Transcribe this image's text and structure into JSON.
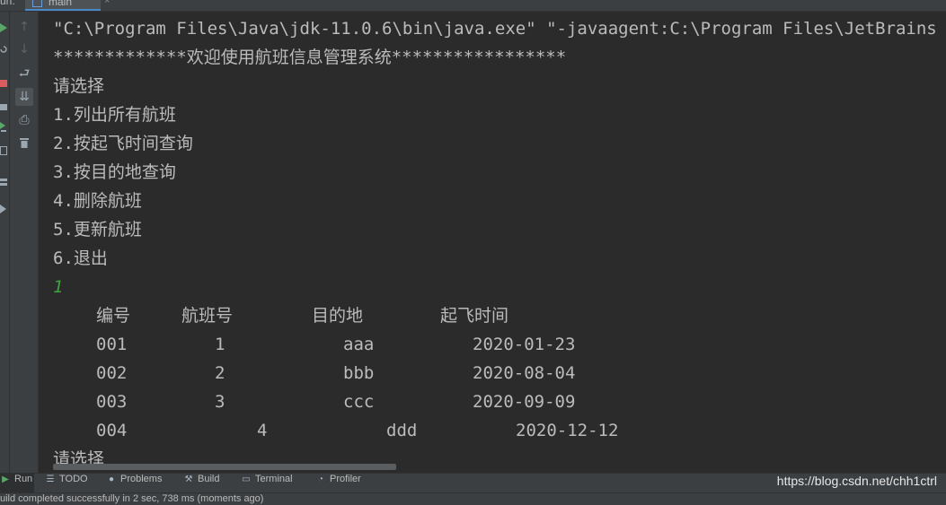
{
  "tab": {
    "prefix": "un:",
    "label": "main",
    "close": "×"
  },
  "toolbar": {
    "up": "↑",
    "down": "↓",
    "wrap": "⮐",
    "scroll_end": "⇊",
    "print": "⎙",
    "trash": "🗑"
  },
  "console": {
    "lines": [
      "\"C:\\Program Files\\Java\\jdk-11.0.6\\bin\\java.exe\" \"-javaagent:C:\\Program Files\\JetBrains",
      "*************欢迎使用航班信息管理系统*****************",
      "请选择",
      "1.列出所有航班",
      "2.按起飞时间查询",
      "3.按目的地查询",
      "4.删除航班",
      "5.更新航班",
      "6.退出"
    ],
    "user_input": "1",
    "table": {
      "headers": [
        "编号",
        "航班号",
        "目的地",
        "起飞时间"
      ],
      "rows": [
        [
          "001",
          "1",
          "aaa",
          "2020-01-23"
        ],
        [
          "002",
          "2",
          "bbb",
          "2020-08-04"
        ],
        [
          "003",
          "3",
          "ccc",
          "2020-09-09"
        ],
        [
          "004",
          "4",
          "ddd",
          "2020-12-12"
        ]
      ]
    },
    "prompt_again": "请选择"
  },
  "bottom_tabs": [
    {
      "label": "Run",
      "icon": "run-icon"
    },
    {
      "label": "TODO",
      "icon": "list-icon"
    },
    {
      "label": "Problems",
      "icon": "problems-icon"
    },
    {
      "label": "Build",
      "icon": "build-icon"
    },
    {
      "label": "Terminal",
      "icon": "terminal-icon"
    },
    {
      "label": "Profiler",
      "icon": "profiler-icon"
    }
  ],
  "watermark": "https://blog.csdn.net/chh1ctrl",
  "status": "uild completed successfully in 2 sec, 738 ms (moments ago)"
}
